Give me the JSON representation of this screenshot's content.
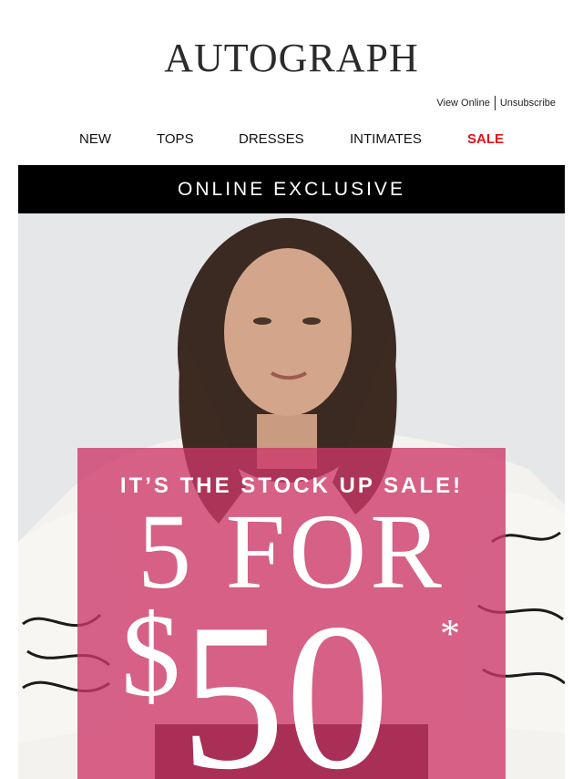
{
  "brand": {
    "logo_text": "AUTOGRAPH"
  },
  "header_links": {
    "view_online": "View Online",
    "unsubscribe": "Unsubscribe"
  },
  "nav": {
    "items": [
      "NEW",
      "TOPS",
      "DRESSES",
      "INTIMATES",
      "SALE"
    ],
    "sale_color": "#e0141b"
  },
  "hero": {
    "banner": "ONLINE EXCLUSIVE",
    "kicker": "IT’S THE STOCK UP SALE!",
    "headline": "5 FOR",
    "price_currency": "$",
    "price_value": "50",
    "asterisk": "*",
    "promo_color": "#cd3769"
  }
}
